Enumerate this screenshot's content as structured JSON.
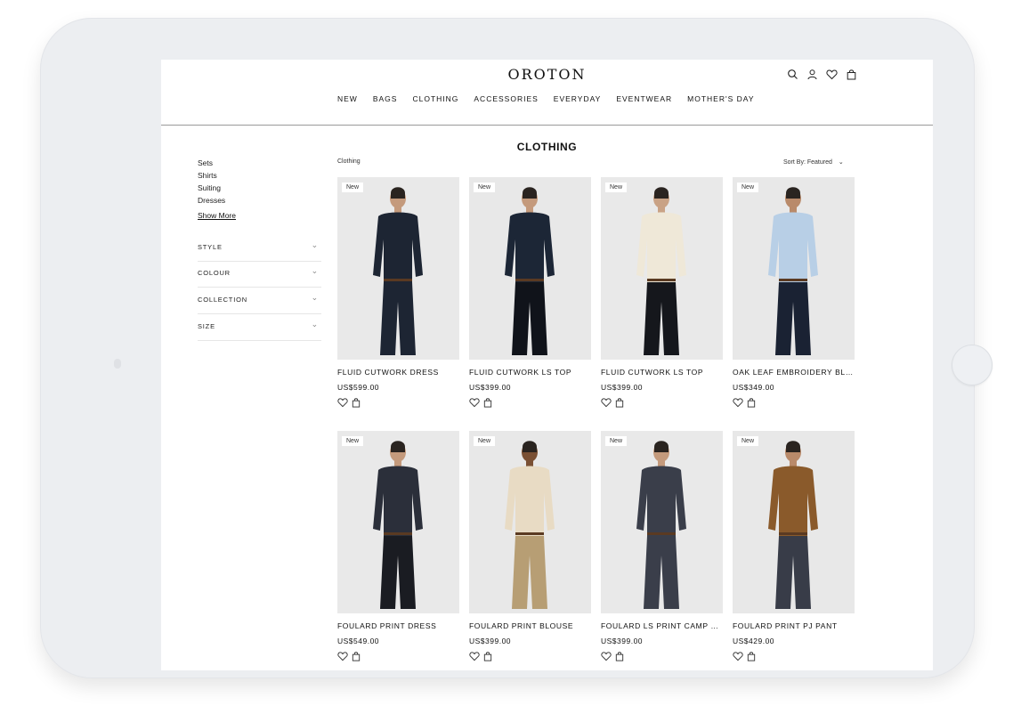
{
  "header": {
    "logo": "OROTON",
    "nav": [
      "NEW",
      "BAGS",
      "CLOTHING",
      "ACCESSORIES",
      "EVERYDAY",
      "EVENTWEAR",
      "MOTHER'S DAY"
    ],
    "icons": [
      "search-icon",
      "account-icon",
      "wishlist-icon",
      "bag-icon"
    ]
  },
  "page": {
    "title": "CLOTHING",
    "breadcrumb": "Clothing",
    "sort_label": "Sort By: Featured"
  },
  "sidebar": {
    "categories": [
      "Sets",
      "Shirts",
      "Suiting",
      "Dresses"
    ],
    "show_more": "Show More",
    "filters": [
      "STYLE",
      "COLOUR",
      "COLLECTION",
      "SIZE"
    ]
  },
  "products": [
    {
      "badge": "New",
      "name": "FLUID CUTWORK DRESS",
      "price": "US$599.00",
      "colors": {
        "bg": "#e9e9e9",
        "top": "#1d2533",
        "bottom": "#1d2533",
        "skin": "#c49a7c"
      }
    },
    {
      "badge": "New",
      "name": "FLUID CUTWORK LS TOP",
      "price": "US$399.00",
      "colors": {
        "bg": "#e8e8e8",
        "top": "#1c2636",
        "bottom": "#10131a",
        "skin": "#c49a7c"
      }
    },
    {
      "badge": "New",
      "name": "FLUID CUTWORK LS TOP",
      "price": "US$399.00",
      "colors": {
        "bg": "#e9e9e9",
        "top": "#efe8d8",
        "bottom": "#15171c",
        "skin": "#c9a285"
      }
    },
    {
      "badge": "New",
      "name": "OAK LEAF EMBROIDERY BLO...",
      "price": "US$349.00",
      "colors": {
        "bg": "#e8e8e8",
        "top": "#b8cfe6",
        "bottom": "#1a2233",
        "skin": "#b98a6a"
      }
    },
    {
      "badge": "New",
      "name": "FOULARD PRINT DRESS",
      "price": "US$549.00",
      "colors": {
        "bg": "#e9e9e9",
        "top": "#2b2f3a",
        "bottom": "#1a1c22",
        "skin": "#c49a7c"
      }
    },
    {
      "badge": "New",
      "name": "FOULARD PRINT BLOUSE",
      "price": "US$399.00",
      "colors": {
        "bg": "#e8e8e8",
        "top": "#e8dbc4",
        "bottom": "#b79e74",
        "skin": "#7a5034"
      }
    },
    {
      "badge": "New",
      "name": "FOULARD LS PRINT CAMP S...",
      "price": "US$399.00",
      "colors": {
        "bg": "#e9e9e9",
        "top": "#3a3e4a",
        "bottom": "#3a3e4a",
        "skin": "#c49a7c"
      }
    },
    {
      "badge": "New",
      "name": "FOULARD PRINT PJ PANT",
      "price": "US$429.00",
      "colors": {
        "bg": "#e8e8e8",
        "top": "#8a5a2b",
        "bottom": "#383c48",
        "skin": "#b98a6a"
      }
    }
  ],
  "product_actions": [
    "wishlist-icon",
    "add-to-bag-icon"
  ]
}
